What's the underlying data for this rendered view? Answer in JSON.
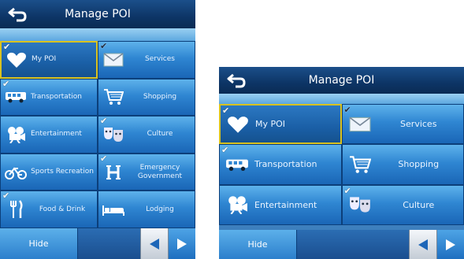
{
  "title": "Manage POI",
  "hide_label": "Hide",
  "colors": {
    "accent": "#2f86d2",
    "selected_border": "#d9c21f",
    "title_bar": "#0d3566"
  },
  "screen_left": {
    "tiles": [
      {
        "label": "My POI",
        "icon": "heart-icon",
        "checked": true,
        "selected": true
      },
      {
        "label": "Services",
        "icon": "envelope-icon",
        "checked": true
      },
      {
        "label": "Transportation",
        "icon": "bus-icon",
        "checked": true
      },
      {
        "label": "Shopping",
        "icon": "cart-icon",
        "checked": false
      },
      {
        "label": "Entertainment",
        "icon": "film-projector-icon",
        "checked": false
      },
      {
        "label": "Culture",
        "icon": "masks-icon",
        "checked": true
      },
      {
        "label": "Sports Recreation",
        "icon": "bicycle-icon",
        "checked": false
      },
      {
        "label": "Emergency Government",
        "icon": "hospital-icon",
        "checked": true
      },
      {
        "label": "Food & Drink",
        "icon": "fork-knife-icon",
        "checked": true
      },
      {
        "label": "Lodging",
        "icon": "bed-icon",
        "checked": false
      }
    ]
  },
  "screen_right": {
    "tiles": [
      {
        "label": "My POI",
        "icon": "heart-icon",
        "checked": true,
        "selected": true
      },
      {
        "label": "Services",
        "icon": "envelope-icon",
        "checked": true
      },
      {
        "label": "Transportation",
        "icon": "bus-icon",
        "checked": true
      },
      {
        "label": "Shopping",
        "icon": "cart-icon",
        "checked": false
      },
      {
        "label": "Entertainment",
        "icon": "film-projector-icon",
        "checked": false
      },
      {
        "label": "Culture",
        "icon": "masks-icon",
        "checked": true
      }
    ]
  }
}
